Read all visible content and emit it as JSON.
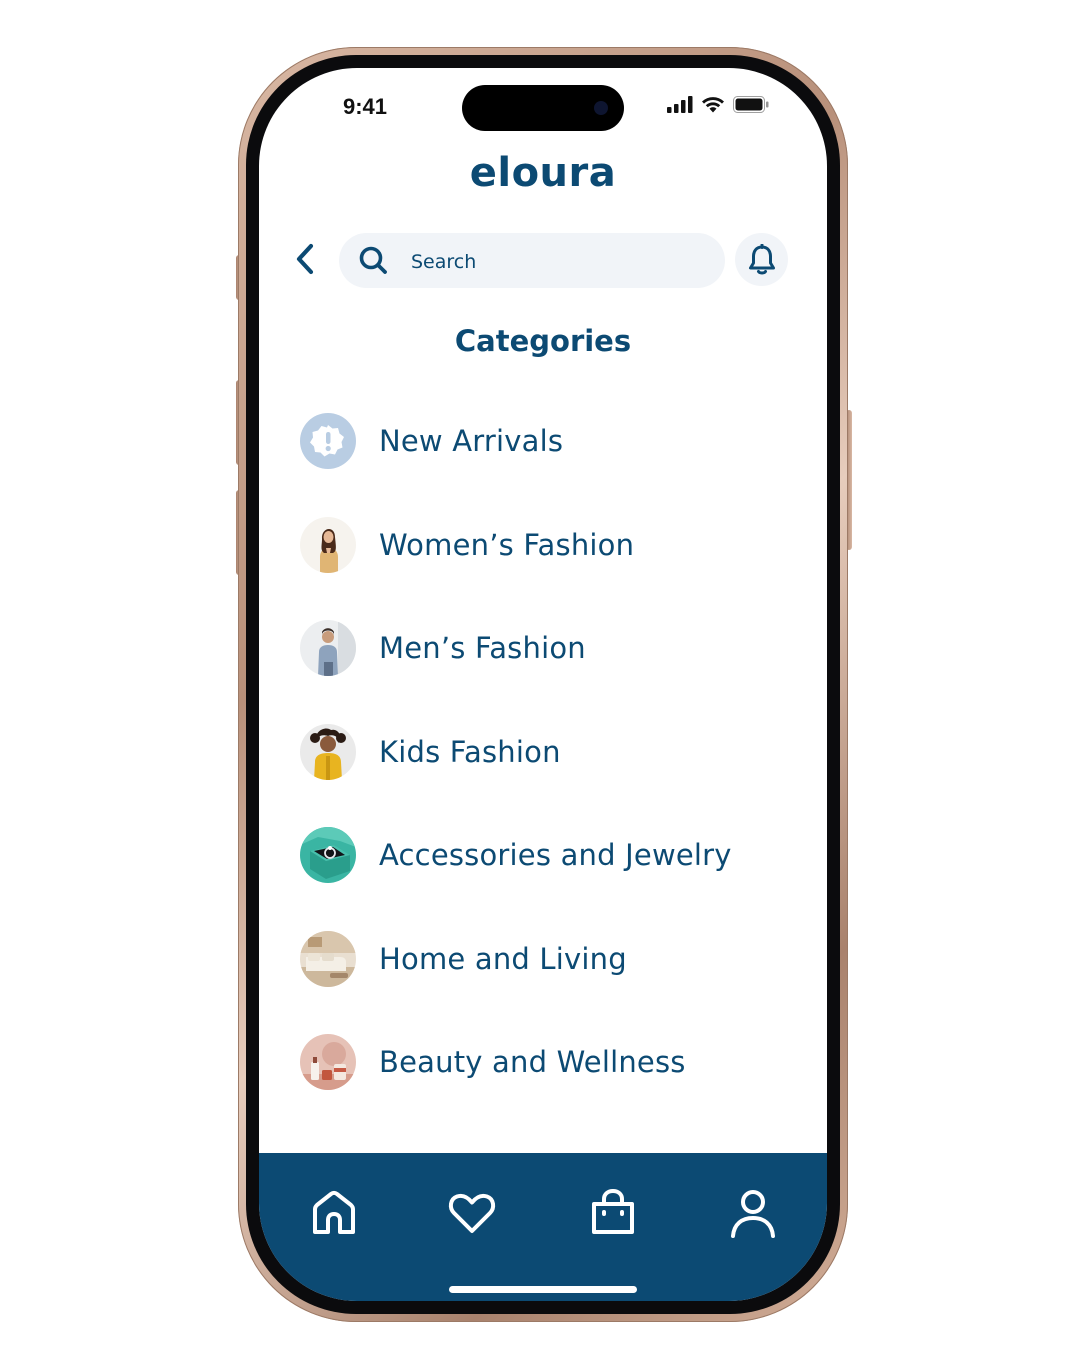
{
  "status_bar": {
    "time": "9:41"
  },
  "header": {
    "app_name": "eloura"
  },
  "search": {
    "placeholder": "Search"
  },
  "categories_section": {
    "title": "Categories",
    "items": [
      {
        "label": "New Arrivals",
        "icon": "badge-alert-icon"
      },
      {
        "label": "Women’s Fashion",
        "icon": "women-fashion-thumbnail"
      },
      {
        "label": "Men’s Fashion",
        "icon": "men-fashion-thumbnail"
      },
      {
        "label": "Kids Fashion",
        "icon": "kids-fashion-thumbnail"
      },
      {
        "label": "Accessories and Jewelry",
        "icon": "ring-box-thumbnail"
      },
      {
        "label": "Home and Living",
        "icon": "living-room-thumbnail"
      },
      {
        "label": "Beauty and Wellness",
        "icon": "cosmetics-thumbnail"
      }
    ]
  },
  "bottom_nav": {
    "items": [
      {
        "name": "home",
        "icon": "home-icon"
      },
      {
        "name": "favorites",
        "icon": "heart-icon"
      },
      {
        "name": "bag",
        "icon": "shopping-bag-icon"
      },
      {
        "name": "profile",
        "icon": "user-icon"
      }
    ]
  },
  "colors": {
    "primary": "#0c4a73",
    "search_bg": "#f1f4f8",
    "new_arrivals_icon_bg": "#b9cde3",
    "phone_frame": "#c9a48f"
  }
}
